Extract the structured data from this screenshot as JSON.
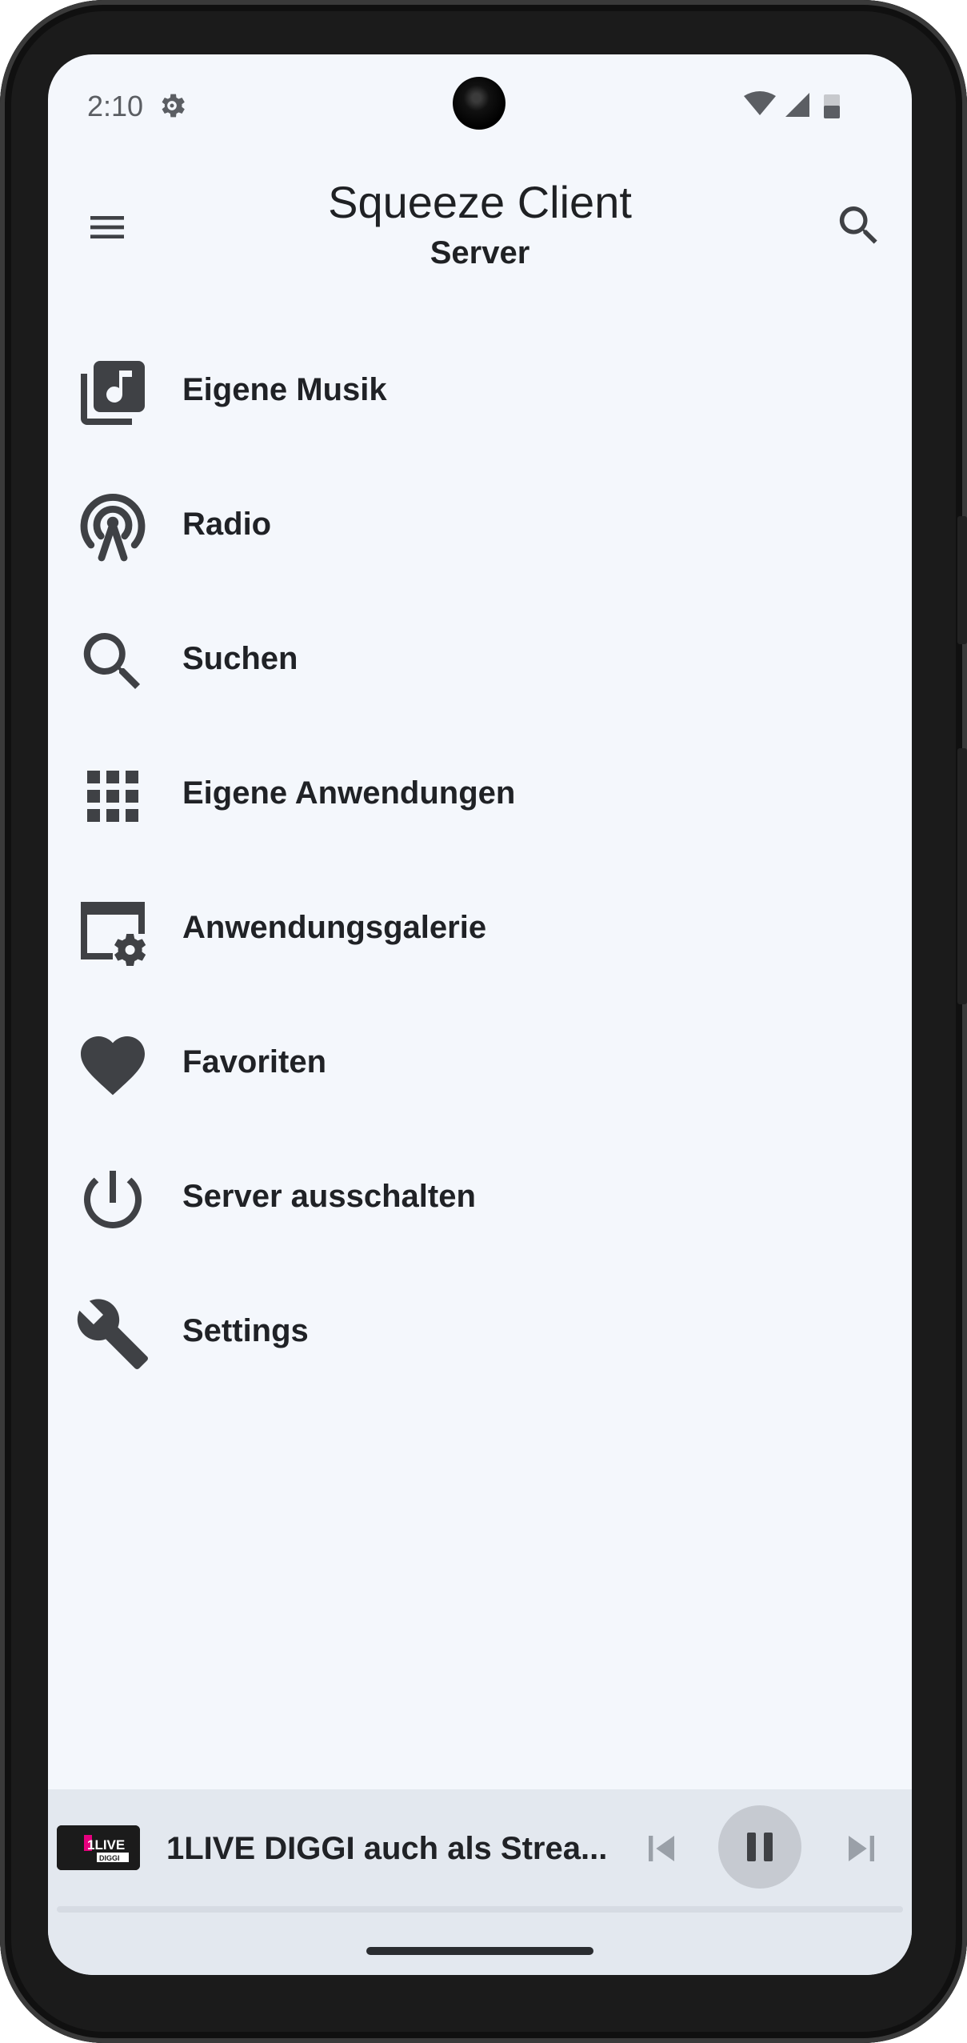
{
  "status_bar": {
    "time": "2:10",
    "icons": [
      "settings-gear-icon",
      "wifi-icon",
      "signal-icon",
      "battery-icon"
    ]
  },
  "app_bar": {
    "title": "Squeeze Client",
    "subtitle": "Server",
    "icons": [
      "hamburger-menu-icon",
      "search-icon"
    ]
  },
  "menu": {
    "items": [
      {
        "label": "Eigene Musik",
        "icon": "music-library-icon"
      },
      {
        "label": "Radio",
        "icon": "radio-tower-icon"
      },
      {
        "label": "Suchen",
        "icon": "search-icon"
      },
      {
        "label": "Eigene Anwendungen",
        "icon": "apps-grid-icon"
      },
      {
        "label": "Anwendungsgalerie",
        "icon": "app-gallery-icon"
      },
      {
        "label": "Favoriten",
        "icon": "heart-icon"
      },
      {
        "label": "Server ausschalten",
        "icon": "power-icon"
      },
      {
        "label": "Settings",
        "icon": "wrench-icon"
      }
    ]
  },
  "now_playing": {
    "title": "1LIVE DIGGI auch als Strea...",
    "art_text_main": "1LIVE",
    "art_text_sub": "DIGGI",
    "state": "playing",
    "progress_fraction": 0.0,
    "controls": [
      "skip-previous-icon",
      "pause-icon",
      "skip-next-icon"
    ]
  },
  "colors": {
    "background": "#f4f7fc",
    "player_bar": "#e3e8ef",
    "icon": "#3f4145",
    "text": "#202226",
    "brand_pink": "#e6007e"
  }
}
